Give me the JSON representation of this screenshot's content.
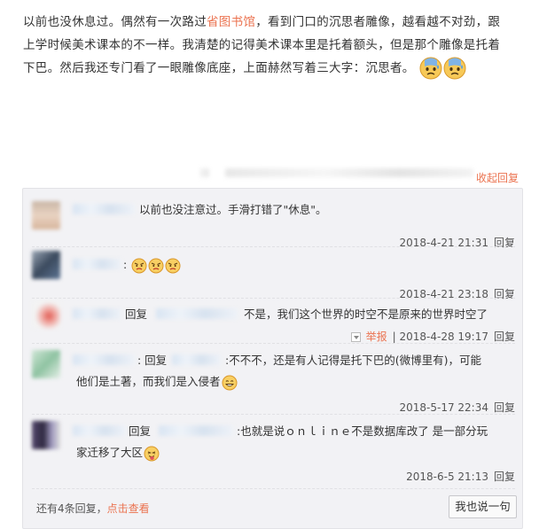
{
  "post": {
    "text_before_link": "以前也没休息过。偶然有一次路过",
    "link_text": "省图书馆",
    "text_after_link": "，看到门口的沉思者雕像，越看越不对劲，跟上学时候美术课本的不一样。我清楚的记得美术课本里是托着额头，但是那个雕像是托着下巴。然后我还专门看了一眼雕像底座，上面赫然写着三大字：沉思者。",
    "emojis": [
      "sweat-emoji",
      "sweat-emoji"
    ]
  },
  "fold": {
    "label": "收起回复"
  },
  "comments": [
    {
      "text": "以前也没注意过。手滑打错了\"休息\"。",
      "time": "2018-4-21 21:31",
      "reply_label": "回复"
    },
    {
      "text": ":",
      "emojis": [
        "angry-emoji",
        "angry-emoji",
        "angry-emoji"
      ],
      "time": "2018-4-21 23:18",
      "reply_label": "回复"
    },
    {
      "reply_prefix": "回复",
      "text": "不是，我们这个世界的时空不是原来的世界时空了",
      "report_label": "举报",
      "time": "2018-4-28 19:17",
      "reply_label": "回复"
    },
    {
      "reply_prefix": ": 回复",
      "text_line1": ":不不不，还是有人记得是托下巴的(微博里有)，可能",
      "text_line2": "他们是土著，而我们是入侵者",
      "emojis": [
        "grin-emoji"
      ],
      "time": "2018-5-17 22:34",
      "reply_label": "回复"
    },
    {
      "reply_prefix": "回复",
      "text_line1": ":也就是说ｏｎｌｉｎｅ不是数据库改了 是一部分玩",
      "text_line2": "家迁移了大区",
      "emojis": [
        "tongue-emoji"
      ],
      "time": "2018-6-5 21:13",
      "reply_label": "回复"
    }
  ],
  "footer": {
    "more_text": "还有4条回复，",
    "more_link": "点击查看",
    "reply_button": "我也说一句"
  }
}
